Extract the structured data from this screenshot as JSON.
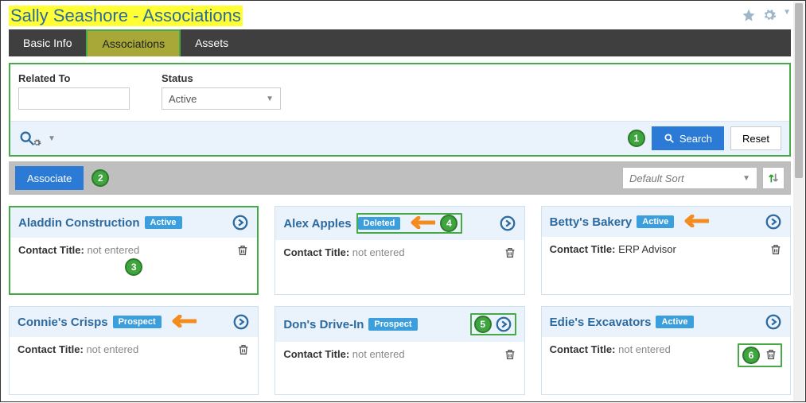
{
  "header": {
    "title": "Sally Seashore - Associations"
  },
  "tabs": [
    {
      "label": "Basic Info",
      "active": false
    },
    {
      "label": "Associations",
      "active": true
    },
    {
      "label": "Assets",
      "active": false
    }
  ],
  "filters": {
    "related_to_label": "Related To",
    "related_to_value": "",
    "status_label": "Status",
    "status_value": "Active",
    "search_label": "Search",
    "reset_label": "Reset"
  },
  "toolbar": {
    "associate_label": "Associate",
    "sort_label": "Default Sort"
  },
  "contact_title_label": "Contact Title:",
  "not_entered": "not entered",
  "cards": [
    {
      "name": "Aladdin Construction",
      "status": "Active",
      "contact_title": "not entered"
    },
    {
      "name": "Alex Apples",
      "status": "Deleted",
      "contact_title": "not entered"
    },
    {
      "name": "Betty's Bakery",
      "status": "Active",
      "contact_title": "ERP Advisor"
    },
    {
      "name": "Connie's Crisps",
      "status": "Prospect",
      "contact_title": "not entered"
    },
    {
      "name": "Don's Drive-In",
      "status": "Prospect",
      "contact_title": "not entered"
    },
    {
      "name": "Edie's Excavators",
      "status": "Active",
      "contact_title": "not entered"
    }
  ],
  "callouts": [
    "1",
    "2",
    "3",
    "4",
    "5",
    "6"
  ]
}
